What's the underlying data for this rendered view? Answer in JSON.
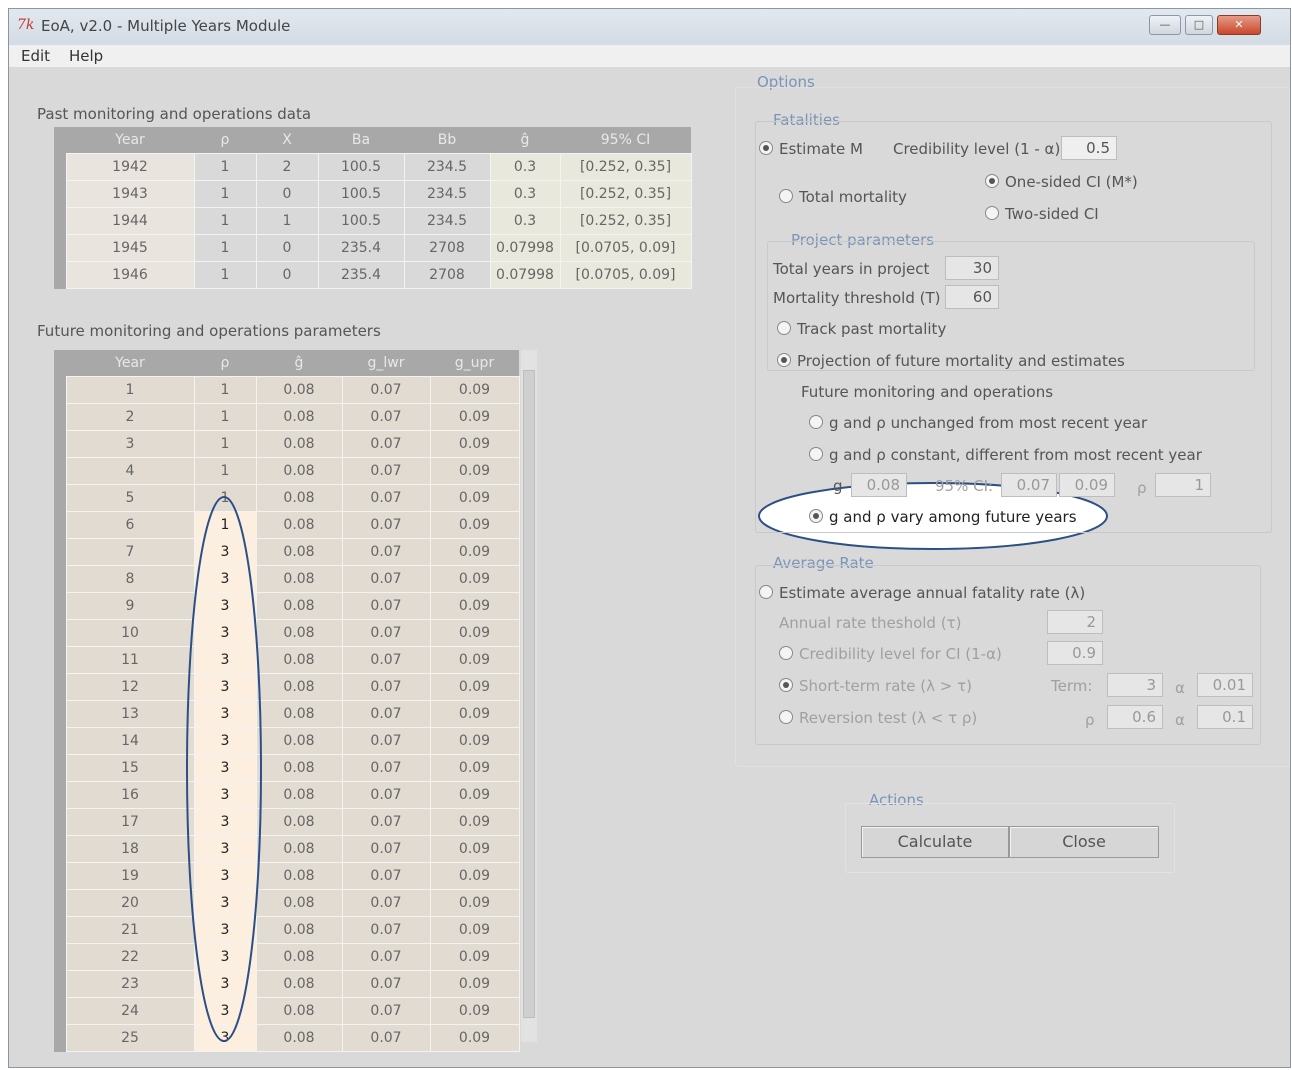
{
  "window": {
    "title": "EoA, v2.0 - Multiple Years Module",
    "tk_logo": "7k",
    "min": "—",
    "max": "□",
    "close": "✕"
  },
  "menu": {
    "edit": "Edit",
    "help": "Help"
  },
  "past": {
    "title": "Past monitoring and operations data",
    "headers": [
      "Year",
      "ρ",
      "X",
      "Ba",
      "Bb",
      "ĝ",
      "95% CI"
    ],
    "rows": [
      [
        "1942",
        "1",
        "2",
        "100.5",
        "234.5",
        "0.3",
        "[0.252, 0.35]"
      ],
      [
        "1943",
        "1",
        "0",
        "100.5",
        "234.5",
        "0.3",
        "[0.252, 0.35]"
      ],
      [
        "1944",
        "1",
        "1",
        "100.5",
        "234.5",
        "0.3",
        "[0.252, 0.35]"
      ],
      [
        "1945",
        "1",
        "0",
        "235.4",
        "2708",
        "0.07998",
        "[0.0705, 0.09]"
      ],
      [
        "1946",
        "1",
        "0",
        "235.4",
        "2708",
        "0.07998",
        "[0.0705, 0.09]"
      ]
    ]
  },
  "future": {
    "title": "Future monitoring and operations parameters",
    "headers": [
      "Year",
      "ρ",
      "ĝ",
      "g_lwr",
      "g_upr"
    ],
    "rows": [
      [
        "1",
        "1",
        "0.08",
        "0.07",
        "0.09"
      ],
      [
        "2",
        "1",
        "0.08",
        "0.07",
        "0.09"
      ],
      [
        "3",
        "1",
        "0.08",
        "0.07",
        "0.09"
      ],
      [
        "4",
        "1",
        "0.08",
        "0.07",
        "0.09"
      ],
      [
        "5",
        "1",
        "0.08",
        "0.07",
        "0.09"
      ],
      [
        "6",
        "1",
        "0.08",
        "0.07",
        "0.09"
      ],
      [
        "7",
        "3",
        "0.08",
        "0.07",
        "0.09"
      ],
      [
        "8",
        "3",
        "0.08",
        "0.07",
        "0.09"
      ],
      [
        "9",
        "3",
        "0.08",
        "0.07",
        "0.09"
      ],
      [
        "10",
        "3",
        "0.08",
        "0.07",
        "0.09"
      ],
      [
        "11",
        "3",
        "0.08",
        "0.07",
        "0.09"
      ],
      [
        "12",
        "3",
        "0.08",
        "0.07",
        "0.09"
      ],
      [
        "13",
        "3",
        "0.08",
        "0.07",
        "0.09"
      ],
      [
        "14",
        "3",
        "0.08",
        "0.07",
        "0.09"
      ],
      [
        "15",
        "3",
        "0.08",
        "0.07",
        "0.09"
      ],
      [
        "16",
        "3",
        "0.08",
        "0.07",
        "0.09"
      ],
      [
        "17",
        "3",
        "0.08",
        "0.07",
        "0.09"
      ],
      [
        "18",
        "3",
        "0.08",
        "0.07",
        "0.09"
      ],
      [
        "19",
        "3",
        "0.08",
        "0.07",
        "0.09"
      ],
      [
        "20",
        "3",
        "0.08",
        "0.07",
        "0.09"
      ],
      [
        "21",
        "3",
        "0.08",
        "0.07",
        "0.09"
      ],
      [
        "22",
        "3",
        "0.08",
        "0.07",
        "0.09"
      ],
      [
        "23",
        "3",
        "0.08",
        "0.07",
        "0.09"
      ],
      [
        "24",
        "3",
        "0.08",
        "0.07",
        "0.09"
      ],
      [
        "25",
        "3",
        "0.08",
        "0.07",
        "0.09"
      ]
    ]
  },
  "options": {
    "title": "Options",
    "fatalities": {
      "title": "Fatalities",
      "estimate_m": "Estimate M",
      "cred_label": "Credibility level (1 - α)",
      "cred_value": "0.5",
      "total_mortality": "Total mortality",
      "one_sided": "One-sided CI (M*)",
      "two_sided": "Two-sided CI"
    },
    "project": {
      "title": "Project parameters",
      "total_years_label": "Total years in project",
      "total_years_value": "30",
      "threshold_label": "Mortality threshold (T)",
      "threshold_value": "60",
      "track_past": "Track past mortality",
      "projection": "Projection of future mortality and estimates",
      "future_mon": "Future monitoring and operations",
      "unchanged": "g and ρ unchanged from most recent year",
      "constant": "g and ρ constant, different from most recent year",
      "g_label": "g",
      "g_value": "0.08",
      "ci_label": "95% CI:",
      "ci_lo": "0.07",
      "ci_hi": "0.09",
      "rho_label": "ρ",
      "rho_value": "1",
      "vary": "g and ρ vary among future years"
    },
    "avg_rate": {
      "title": "Average Rate",
      "estimate": "Estimate average annual fatality rate (λ)",
      "annual_thresh_label": "Annual rate theshold (τ)",
      "annual_thresh_value": "2",
      "cred_ci_label": "Credibility level for CI (1-α)",
      "cred_ci_value": "0.9",
      "short_term": "Short-term rate (λ > τ)",
      "term_label": "Term:",
      "term_value": "3",
      "alpha_label": "α",
      "alpha1_value": "0.01",
      "reversion": "Reversion test (λ < τ ρ)",
      "rho_label": "ρ",
      "rho_value": "0.6",
      "alpha2_value": "0.1"
    }
  },
  "actions": {
    "title": "Actions",
    "calculate": "Calculate",
    "close": "Close"
  },
  "colors": {
    "highlight_oval": "#2c4f86",
    "group_title": "#7a95b8",
    "header_bg": "#a8a8a8"
  }
}
